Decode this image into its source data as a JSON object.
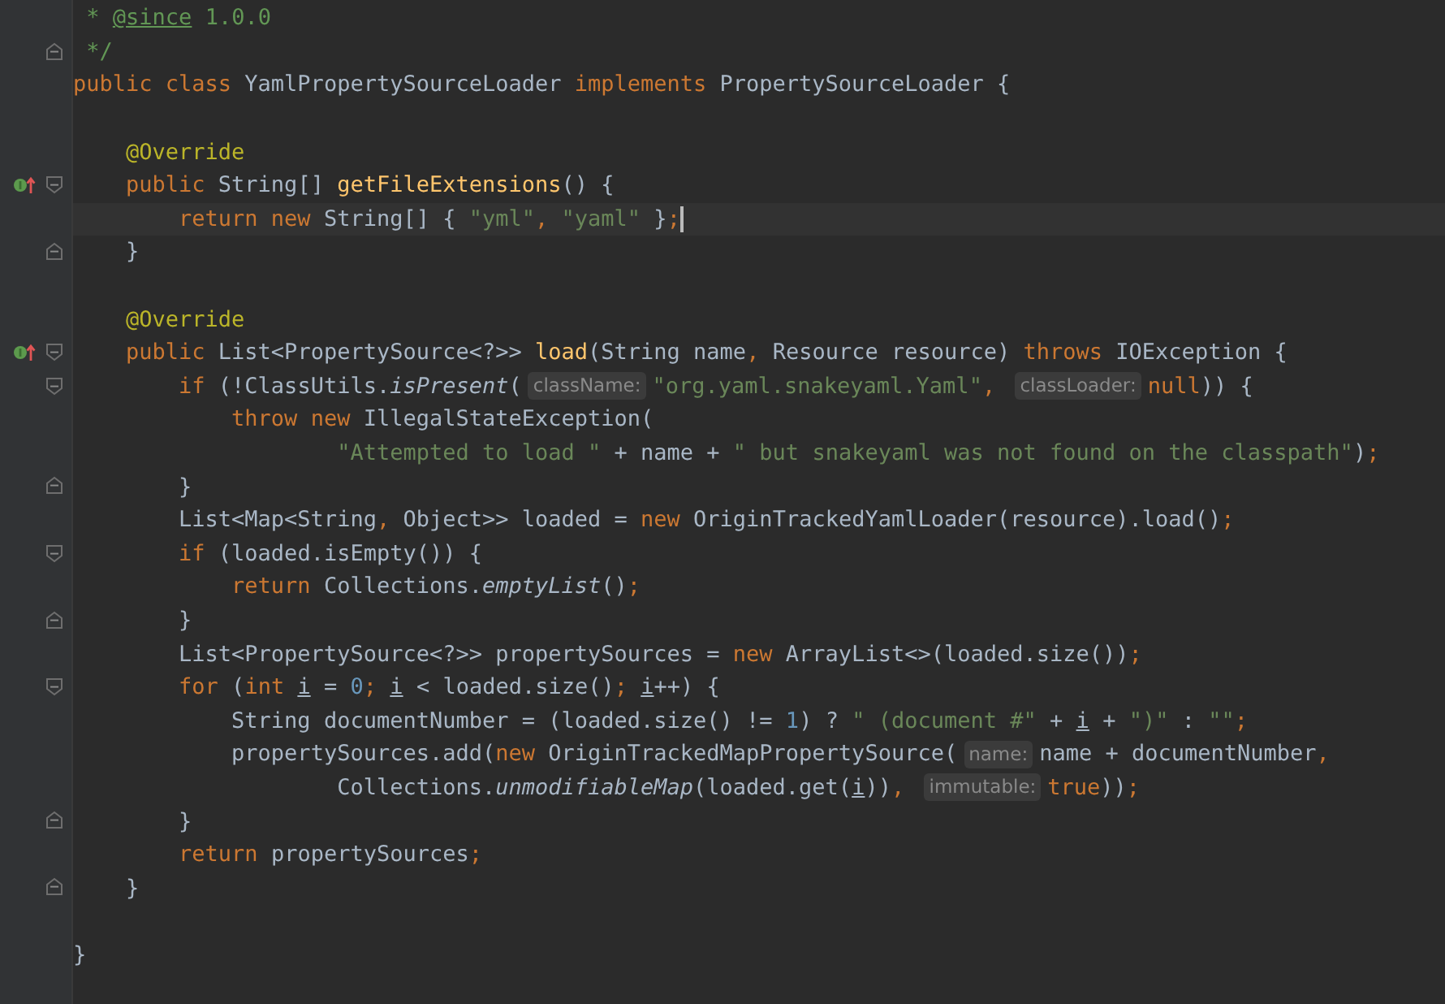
{
  "editor": {
    "lines": [
      {
        "tokens": [
          {
            "kind": "c",
            "text": " * "
          },
          {
            "kind": "d",
            "text": "@since"
          },
          {
            "kind": "c",
            "text": " 1.0.0"
          }
        ]
      },
      {
        "fold_close": true,
        "tokens": [
          {
            "kind": "c",
            "text": " */"
          }
        ]
      },
      {
        "gap_after": true,
        "tokens": [
          {
            "kind": "k",
            "text": "public class "
          },
          {
            "kind": "t",
            "text": "YamlPropertySourceLoader "
          },
          {
            "kind": "k",
            "text": "implements "
          },
          {
            "kind": "t",
            "text": "PropertySourceLoader {"
          }
        ]
      },
      {
        "tokens": [
          {
            "kind": "a",
            "text": "    @Override"
          }
        ]
      },
      {
        "fold_open": true,
        "marker": true,
        "tokens": [
          {
            "kind": "k",
            "text": "    public "
          },
          {
            "kind": "t",
            "text": "String[] "
          },
          {
            "kind": "m",
            "text": "getFileExtensions"
          },
          {
            "kind": "t",
            "text": "() {"
          }
        ]
      },
      {
        "current": true,
        "tokens": [
          {
            "kind": "k",
            "text": "        return new "
          },
          {
            "kind": "t",
            "text": "String[] { "
          },
          {
            "kind": "s",
            "text": "\"yml\""
          },
          {
            "kind": "k",
            "text": ", "
          },
          {
            "kind": "s",
            "text": "\"yaml\""
          },
          {
            "kind": "t",
            "text": " }"
          },
          {
            "kind": "k",
            "text": ";"
          }
        ]
      },
      {
        "fold_close": true,
        "gap_after": true,
        "tokens": [
          {
            "kind": "t",
            "text": "    }"
          }
        ]
      },
      {
        "tokens": [
          {
            "kind": "a",
            "text": "    @Override"
          }
        ]
      },
      {
        "fold_open": true,
        "marker": true,
        "tokens": [
          {
            "kind": "k",
            "text": "    public "
          },
          {
            "kind": "t",
            "text": "List<PropertySource<?>> "
          },
          {
            "kind": "m",
            "text": "load"
          },
          {
            "kind": "t",
            "text": "(String name"
          },
          {
            "kind": "k",
            "text": ", "
          },
          {
            "kind": "t",
            "text": "Resource resource) "
          },
          {
            "kind": "k",
            "text": "throws "
          },
          {
            "kind": "t",
            "text": "IOException {"
          }
        ]
      },
      {
        "fold_open": true,
        "tokens": [
          {
            "kind": "k",
            "text": "        if "
          },
          {
            "kind": "t",
            "text": "(!ClassUtils."
          },
          {
            "kind": "it",
            "text": "isPresent"
          },
          {
            "kind": "t",
            "text": "("
          },
          {
            "kind": "h",
            "text": "className:"
          },
          {
            "kind": "s",
            "text": "\"org.yaml.snakeyaml.Yaml\""
          },
          {
            "kind": "k",
            "text": ", "
          },
          {
            "kind": "h",
            "text": "classLoader:"
          },
          {
            "kind": "k",
            "text": "null"
          },
          {
            "kind": "t",
            "text": ")) {"
          }
        ]
      },
      {
        "tokens": [
          {
            "kind": "k",
            "text": "            throw new "
          },
          {
            "kind": "t",
            "text": "IllegalStateException("
          }
        ]
      },
      {
        "tokens": [
          {
            "kind": "s",
            "text": "                    \"Attempted to load \""
          },
          {
            "kind": "t",
            "text": " + name + "
          },
          {
            "kind": "s",
            "text": "\" but snakeyaml was not found on the classpath\""
          },
          {
            "kind": "t",
            "text": ")"
          },
          {
            "kind": "k",
            "text": ";"
          }
        ]
      },
      {
        "fold_close": true,
        "tokens": [
          {
            "kind": "t",
            "text": "        }"
          }
        ]
      },
      {
        "tokens": [
          {
            "kind": "t",
            "text": "        List<Map<String"
          },
          {
            "kind": "k",
            "text": ", "
          },
          {
            "kind": "t",
            "text": "Object>> loaded = "
          },
          {
            "kind": "k",
            "text": "new "
          },
          {
            "kind": "t",
            "text": "OriginTrackedYamlLoader(resource).load()"
          },
          {
            "kind": "k",
            "text": ";"
          }
        ]
      },
      {
        "fold_open": true,
        "tokens": [
          {
            "kind": "k",
            "text": "        if "
          },
          {
            "kind": "t",
            "text": "(loaded.isEmpty()) {"
          }
        ]
      },
      {
        "tokens": [
          {
            "kind": "k",
            "text": "            return "
          },
          {
            "kind": "t",
            "text": "Collections."
          },
          {
            "kind": "it",
            "text": "emptyList"
          },
          {
            "kind": "t",
            "text": "()"
          },
          {
            "kind": "k",
            "text": ";"
          }
        ]
      },
      {
        "fold_close": true,
        "tokens": [
          {
            "kind": "t",
            "text": "        }"
          }
        ]
      },
      {
        "tokens": [
          {
            "kind": "t",
            "text": "        List<PropertySource<?>> propertySources = "
          },
          {
            "kind": "k",
            "text": "new "
          },
          {
            "kind": "t",
            "text": "ArrayList<>(loaded.size())"
          },
          {
            "kind": "k",
            "text": ";"
          }
        ]
      },
      {
        "fold_open": true,
        "tokens": [
          {
            "kind": "k",
            "text": "        for "
          },
          {
            "kind": "t",
            "text": "("
          },
          {
            "kind": "k",
            "text": "int "
          },
          {
            "kind": "u",
            "text": "i"
          },
          {
            "kind": "t",
            "text": " = "
          },
          {
            "kind": "n",
            "text": "0"
          },
          {
            "kind": "k",
            "text": "; "
          },
          {
            "kind": "u",
            "text": "i"
          },
          {
            "kind": "t",
            "text": " < loaded.size()"
          },
          {
            "kind": "k",
            "text": "; "
          },
          {
            "kind": "u",
            "text": "i"
          },
          {
            "kind": "t",
            "text": "++) {"
          }
        ]
      },
      {
        "tokens": [
          {
            "kind": "t",
            "text": "            String documentNumber = (loaded.size() != "
          },
          {
            "kind": "n",
            "text": "1"
          },
          {
            "kind": "t",
            "text": ") ? "
          },
          {
            "kind": "s",
            "text": "\" (document #\""
          },
          {
            "kind": "t",
            "text": " + "
          },
          {
            "kind": "u",
            "text": "i"
          },
          {
            "kind": "t",
            "text": " + "
          },
          {
            "kind": "s",
            "text": "\")\""
          },
          {
            "kind": "t",
            "text": " : "
          },
          {
            "kind": "s",
            "text": "\"\""
          },
          {
            "kind": "k",
            "text": ";"
          }
        ]
      },
      {
        "tokens": [
          {
            "kind": "t",
            "text": "            propertySources.add("
          },
          {
            "kind": "k",
            "text": "new "
          },
          {
            "kind": "t",
            "text": "OriginTrackedMapPropertySource("
          },
          {
            "kind": "h",
            "text": "name:"
          },
          {
            "kind": "t",
            "text": "name + documentNumber"
          },
          {
            "kind": "k",
            "text": ","
          }
        ]
      },
      {
        "tokens": [
          {
            "kind": "t",
            "text": "                    Collections."
          },
          {
            "kind": "it",
            "text": "unmodifiableMap"
          },
          {
            "kind": "t",
            "text": "(loaded.get("
          },
          {
            "kind": "u",
            "text": "i"
          },
          {
            "kind": "t",
            "text": "))"
          },
          {
            "kind": "k",
            "text": ", "
          },
          {
            "kind": "h",
            "text": "immutable:"
          },
          {
            "kind": "k",
            "text": "true"
          },
          {
            "kind": "t",
            "text": "))"
          },
          {
            "kind": "k",
            "text": ";"
          }
        ]
      },
      {
        "fold_close": true,
        "tokens": [
          {
            "kind": "t",
            "text": "        }"
          }
        ]
      },
      {
        "tokens": [
          {
            "kind": "k",
            "text": "        return "
          },
          {
            "kind": "t",
            "text": "propertySources"
          },
          {
            "kind": "k",
            "text": ";"
          }
        ]
      },
      {
        "fold_close": true,
        "gap_after": true,
        "tokens": [
          {
            "kind": "t",
            "text": "    }"
          }
        ]
      },
      {
        "tokens": [
          {
            "kind": "t",
            "text": "}"
          }
        ]
      }
    ]
  }
}
